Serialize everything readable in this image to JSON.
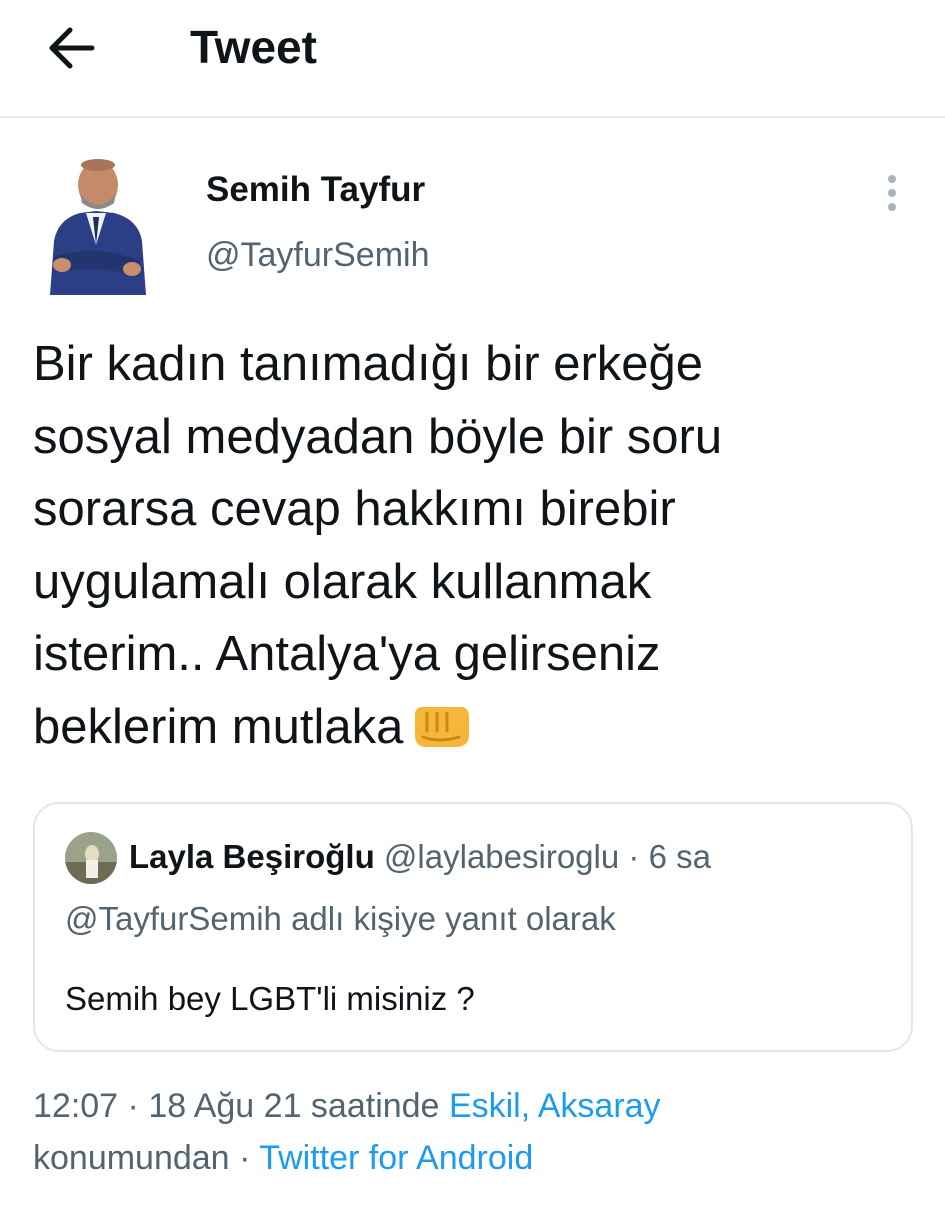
{
  "header": {
    "title": "Tweet",
    "back_icon": "arrow-left-icon"
  },
  "tweet": {
    "author_name": "Semih Tayfur",
    "author_handle": "@TayfurSemih",
    "text_lines": [
      "Bir kadın tanımadığı bir erkeğe",
      "sosyal medyadan böyle bir soru",
      "sorarsa cevap hakkımı birebir",
      "uygulamalı olarak kullanmak",
      "isterim.. Antalya'ya gelirseniz",
      "beklerim mutlaka"
    ],
    "emoji_icon": "oncoming-fist-icon",
    "more_icon": "more-vertical-icon"
  },
  "quote": {
    "name": "Layla Beşiroğlu",
    "handle": "@laylabesiroglu",
    "separator": "·",
    "time": "6 sa",
    "reply_context": "@TayfurSemih adlı kişiye yanıt olarak",
    "text": "Semih bey LGBT'li misiniz ?"
  },
  "meta": {
    "time": "12:07",
    "separator": "·",
    "date_suffix": "18 Ağu 21 saatinde",
    "location": "Eskil, Aksaray",
    "location_suffix": "konumundan",
    "source": "Twitter for Android"
  },
  "colors": {
    "link": "#1d9bf0",
    "secondary_text": "#536471",
    "primary_text": "#0f1419",
    "border": "#e1e8ed"
  }
}
